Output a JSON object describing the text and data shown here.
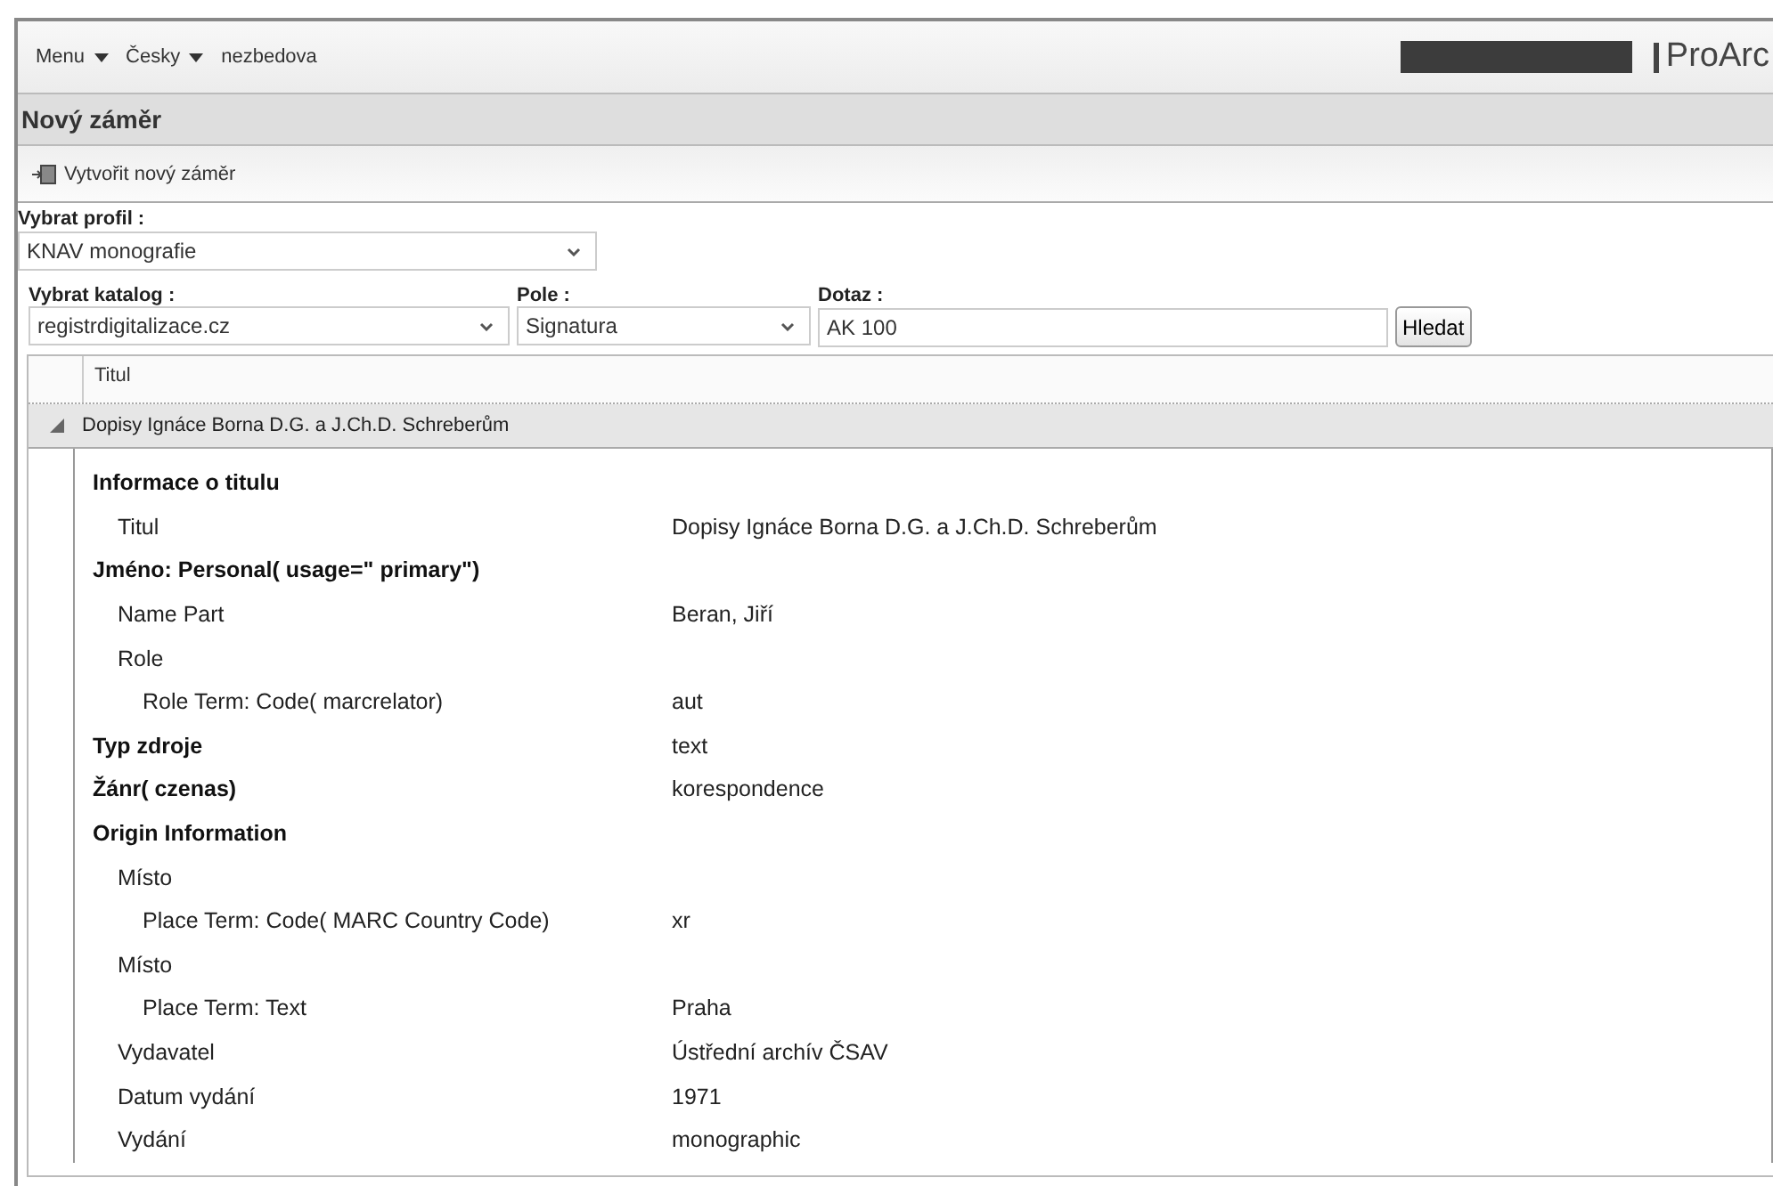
{
  "header": {
    "menus": [
      {
        "label": "Menu",
        "dropdown": true
      },
      {
        "label": "Česky",
        "dropdown": true
      },
      {
        "label": "nezbedova",
        "dropdown": false
      }
    ],
    "logo": "ProArc"
  },
  "title": "Nový záměr",
  "toolbar": {
    "button": "Vytvořit nový záměr"
  },
  "profile": {
    "label": "Vybrat profil :",
    "value": "KNAV monografie"
  },
  "search": {
    "catalog_label": "Vybrat katalog :",
    "catalog": "registrdigitalizace.cz",
    "field_label": "Pole :",
    "field": "Signatura",
    "query_label": "Dotaz :",
    "query": "AK 100",
    "button": "Hledat"
  },
  "grid": {
    "columns": [
      "Titul"
    ],
    "group": {
      "title": "Dopisy Ignáce Borna D.G. a J.Ch.D. Schreberům",
      "expanded": true
    },
    "details": [
      {
        "label": "Informace o titulu",
        "children": [
          {
            "label": "Titul",
            "value": "Dopisy Ignáce Borna D.G. a J.Ch.D. Schreberům"
          }
        ]
      },
      {
        "label": "Jméno: Personal( usage=\" primary\")",
        "children": [
          {
            "label": "Name Part",
            "value": "Beran, Jiří"
          },
          {
            "label": "Role",
            "children": [
              {
                "label": "Role Term: Code( marcrelator)",
                "value": "aut"
              }
            ]
          }
        ]
      },
      {
        "label": "Typ zdroje",
        "value": "text"
      },
      {
        "label": "Žánr( czenas)",
        "value": "korespondence"
      },
      {
        "label": "Origin Information",
        "children": [
          {
            "label": "Místo",
            "children": [
              {
                "label": "Place Term: Code( MARC Country Code)",
                "value": "xr"
              }
            ]
          },
          {
            "label": "Místo",
            "children": [
              {
                "label": "Place Term: Text",
                "value": "Praha"
              }
            ]
          },
          {
            "label": "Vydavatel",
            "value": "Ústřední archív ČSAV"
          },
          {
            "label": "Datum vydání",
            "value": "1971"
          },
          {
            "label": "Vydání",
            "value": "monographic"
          }
        ]
      }
    ]
  }
}
